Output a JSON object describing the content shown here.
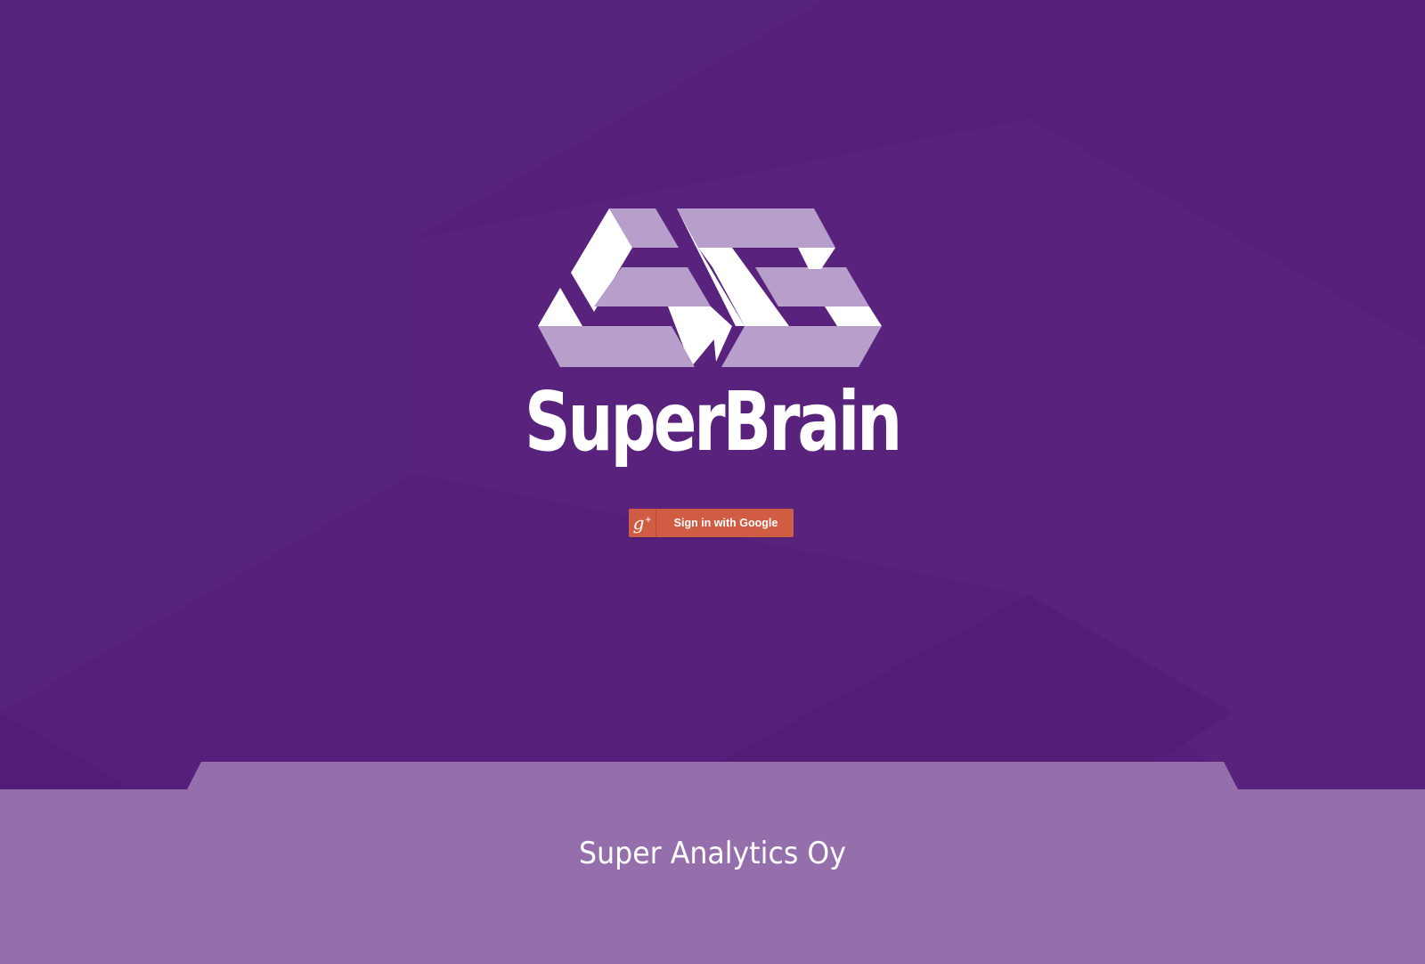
{
  "app": {
    "brand_name": "SuperBrain",
    "company_name": "Super Analytics Oy"
  },
  "auth": {
    "google_button_label": "Sign in with Google",
    "google_icon_text": "g",
    "google_icon_plus": "+"
  },
  "colors": {
    "background": "#561f7b",
    "logo_white": "#ffffff",
    "logo_lavender": "#b89fcb",
    "google_red": "#d05c43",
    "footer": "#956fac"
  },
  "icons": {
    "logo": "superbrain-logo-icon",
    "google": "google-plus-icon"
  }
}
